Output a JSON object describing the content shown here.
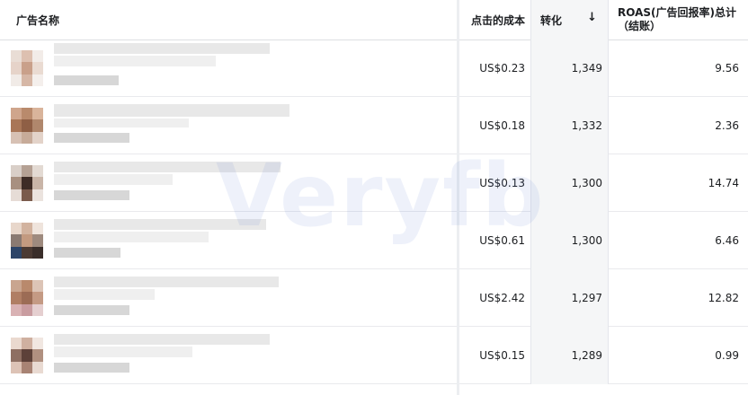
{
  "header": {
    "ad_name": "广告名称",
    "cost_per_click": "点击的成本",
    "conversions": "转化",
    "sort_icon": "arrow-down-icon",
    "roas": "ROAS(广告回报率)总计（结账）"
  },
  "rows": [
    {
      "cpc": "US$0.23",
      "conversions": "1,349",
      "roas": "9.56"
    },
    {
      "cpc": "US$0.18",
      "conversions": "1,332",
      "roas": "2.36"
    },
    {
      "cpc": "US$0.13",
      "conversions": "1,300",
      "roas": "14.74"
    },
    {
      "cpc": "US$0.61",
      "conversions": "1,300",
      "roas": "6.46"
    },
    {
      "cpc": "US$2.42",
      "conversions": "1,297",
      "roas": "12.82"
    },
    {
      "cpc": "US$0.15",
      "conversions": "1,289",
      "roas": "0.99"
    }
  ],
  "watermark": "Veryfb",
  "colors": {
    "sorted_column_bg": "#f5f6f7",
    "border": "#e4e6eb"
  }
}
